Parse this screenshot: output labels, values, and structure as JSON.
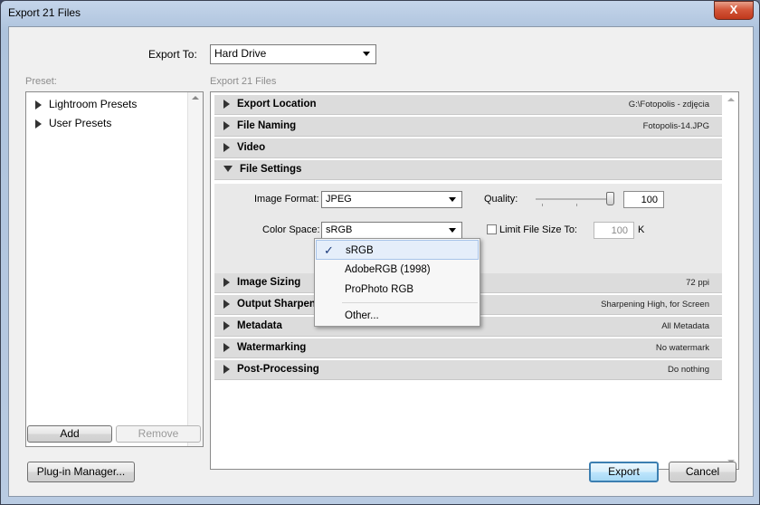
{
  "window": {
    "title": "Export 21 Files",
    "close_glyph": "X"
  },
  "export_to": {
    "label": "Export To:",
    "value": "Hard Drive"
  },
  "preset": {
    "label": "Preset:",
    "items": [
      {
        "label": "Lightroom Presets"
      },
      {
        "label": "User Presets"
      }
    ],
    "add_label": "Add",
    "remove_label": "Remove"
  },
  "main": {
    "header": "Export 21 Files",
    "sections": [
      {
        "name": "Export Location",
        "value": "G:\\Fotopolis - zdjęcia",
        "expanded": false
      },
      {
        "name": "File Naming",
        "value": "Fotopolis-14.JPG",
        "expanded": false
      },
      {
        "name": "Video",
        "value": "",
        "expanded": false
      },
      {
        "name": "File Settings",
        "value": "",
        "expanded": true
      },
      {
        "name": "Image Sizing",
        "value": "72 ppi",
        "expanded": false
      },
      {
        "name": "Output Sharpening",
        "value": "Sharpening High, for Screen",
        "expanded": false
      },
      {
        "name": "Metadata",
        "value": "All Metadata",
        "expanded": false
      },
      {
        "name": "Watermarking",
        "value": "No watermark",
        "expanded": false
      },
      {
        "name": "Post-Processing",
        "value": "Do nothing",
        "expanded": false
      }
    ],
    "file_settings": {
      "image_format_label": "Image Format:",
      "image_format_value": "JPEG",
      "quality_label": "Quality:",
      "quality_value": "100",
      "quality_level": 1.0,
      "color_space_label": "Color Space:",
      "color_space_value": "sRGB",
      "limit_label": "Limit File Size To:",
      "limit_checked": false,
      "limit_value": "100",
      "limit_unit": "K"
    },
    "color_space_menu": {
      "options": [
        {
          "label": "sRGB",
          "checked": true
        },
        {
          "label": "AdobeRGB (1998)",
          "checked": false
        },
        {
          "label": "ProPhoto RGB",
          "checked": false
        },
        {
          "label": "Other...",
          "checked": false
        }
      ],
      "check_glyph": "✓"
    }
  },
  "buttons": {
    "plugin_manager": "Plug-in Manager...",
    "export": "Export",
    "cancel": "Cancel"
  }
}
